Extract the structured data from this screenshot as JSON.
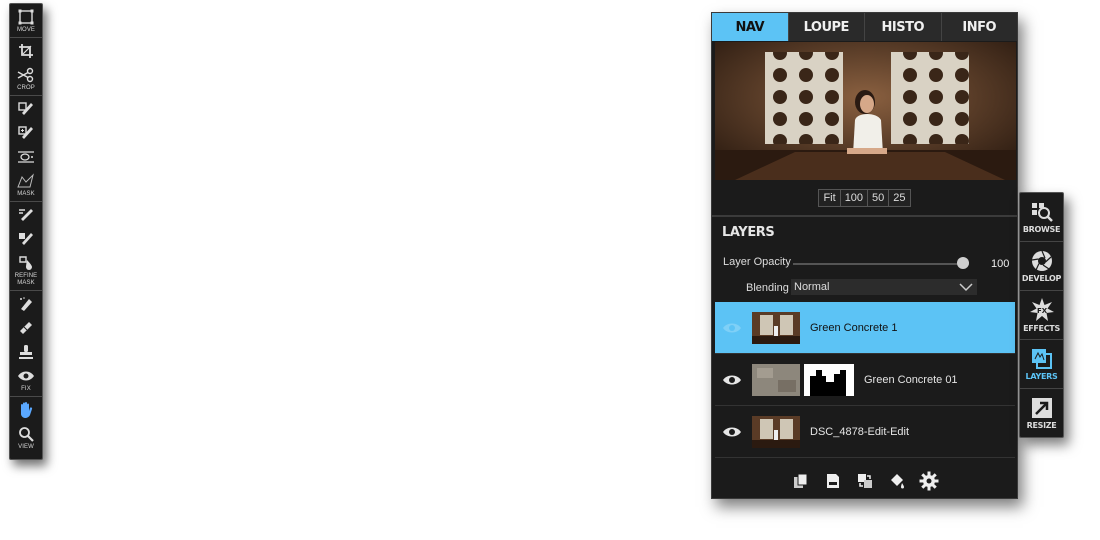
{
  "tool_strip": {
    "groups": [
      {
        "label": "MOVE",
        "tools": [
          "move-icon"
        ]
      },
      {
        "label": "CROP",
        "tools": [
          "crop-icon",
          "scissors-icon"
        ]
      },
      {
        "label": "MASK",
        "tools": [
          "mask-brush-icon",
          "mask-brush-add-icon",
          "mask-line-icon",
          "mask-polygon-icon"
        ]
      },
      {
        "label": "REFINE MASK",
        "tools": [
          "refine-brush-icon",
          "refine-brush-add-icon",
          "refine-droplet-icon"
        ]
      },
      {
        "label": "FIX",
        "tools": [
          "retouch-brush-icon",
          "bandage-icon",
          "clone-stamp-icon",
          "red-eye-icon"
        ]
      },
      {
        "label": "VIEW",
        "tools": [
          "hand-icon",
          "zoom-icon"
        ]
      }
    ],
    "labels": {
      "move": "MOVE",
      "crop": "CROP",
      "mask": "MASK",
      "refine_line1": "REFINE",
      "refine_line2": "MASK",
      "fix": "FIX",
      "view": "VIEW"
    }
  },
  "panel": {
    "tabs": [
      {
        "label": "NAV",
        "active": true
      },
      {
        "label": "LOUPE",
        "active": false
      },
      {
        "label": "HISTO",
        "active": false
      },
      {
        "label": "INFO",
        "active": false
      }
    ],
    "zoom_options": [
      "Fit",
      "100",
      "50",
      "25"
    ],
    "layers_title": "LAYERS",
    "opacity_label": "Layer Opacity",
    "opacity_value": "100",
    "opacity_fraction": 1.0,
    "blending_label": "Blending",
    "blending_value": "Normal",
    "layers": [
      {
        "name": "Green Concrete 1",
        "selected": true,
        "has_mask": false
      },
      {
        "name": "Green Concrete 01",
        "selected": false,
        "has_mask": true
      },
      {
        "name": "DSC_4878-Edit-Edit",
        "selected": false,
        "has_mask": false
      }
    ],
    "bottom_tools": [
      "duplicate-layer-icon",
      "new-layer-icon",
      "merge-layer-icon",
      "fill-bucket-icon",
      "settings-gear-icon"
    ]
  },
  "modules": [
    {
      "label": "BROWSE",
      "icon": "browse-icon",
      "active": false
    },
    {
      "label": "DEVELOP",
      "icon": "aperture-icon",
      "active": false
    },
    {
      "label": "EFFECTS",
      "icon": "fx-burst-icon",
      "active": false
    },
    {
      "label": "LAYERS",
      "icon": "layers-icon",
      "active": true
    },
    {
      "label": "RESIZE",
      "icon": "resize-arrow-icon",
      "active": false
    }
  ],
  "colors": {
    "accent": "#5cc3f5",
    "panel_bg": "#1b1b1b",
    "hand_tool": "#5aa8ff"
  }
}
